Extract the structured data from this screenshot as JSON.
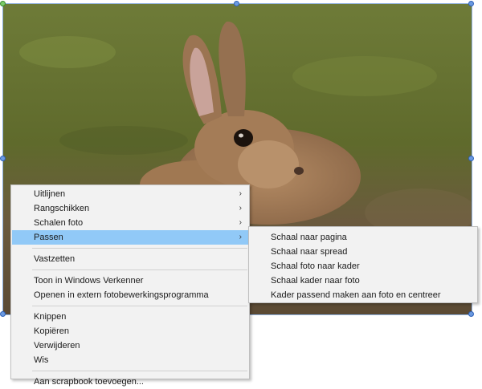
{
  "photo": {
    "subject": "rabbit-photo"
  },
  "context_menu": {
    "groups": [
      [
        {
          "label": "Uitlijnen",
          "submenu": true
        },
        {
          "label": "Rangschikken",
          "submenu": true
        },
        {
          "label": "Schalen foto",
          "submenu": true
        },
        {
          "label": "Passen",
          "submenu": true,
          "highlighted": true
        }
      ],
      [
        {
          "label": "Vastzetten"
        }
      ],
      [
        {
          "label": "Toon in Windows Verkenner"
        },
        {
          "label": "Openen in extern fotobewerkingsprogramma"
        }
      ],
      [
        {
          "label": "Knippen"
        },
        {
          "label": "Kopiëren"
        },
        {
          "label": "Verwijderen"
        },
        {
          "label": "Wis"
        }
      ],
      [
        {
          "label": "Aan scrapbook toevoegen..."
        }
      ]
    ]
  },
  "submenu_passen": {
    "items": [
      {
        "label": "Schaal naar pagina"
      },
      {
        "label": "Schaal naar spread"
      },
      {
        "label": "Schaal foto naar kader"
      },
      {
        "label": "Schaal kader naar foto"
      },
      {
        "label": "Kader passend maken aan foto en centreer"
      }
    ]
  },
  "colors": {
    "highlight": "#91c9f7",
    "menu_bg": "#f2f2f2",
    "handle": "#6b9ae0"
  }
}
